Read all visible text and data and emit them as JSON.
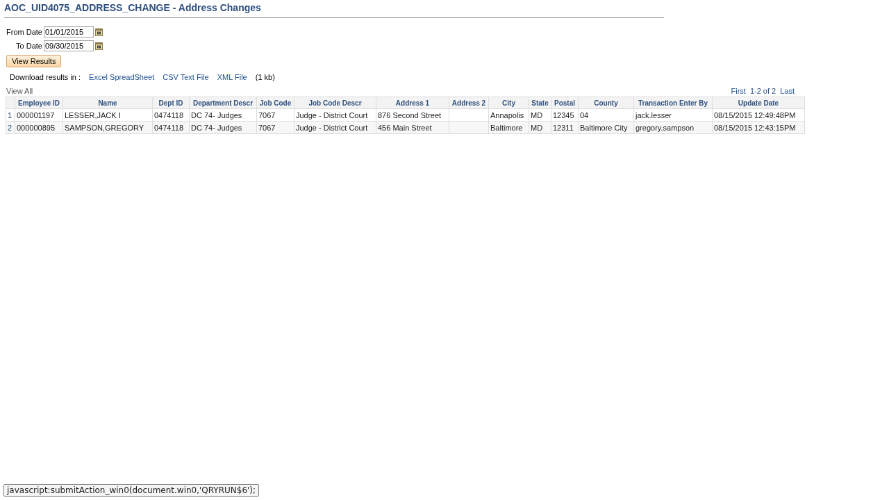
{
  "title": "AOC_UID4075_ADDRESS_CHANGE - Address Changes",
  "date_fields": [
    {
      "label": "From Date",
      "value": "01/01/2015"
    },
    {
      "label": "To Date",
      "value": "09/30/2015"
    }
  ],
  "view_button": "View Results",
  "download": {
    "label": "Download results in :",
    "links": [
      "Excel SpreadSheet",
      "CSV Text File",
      "XML File"
    ],
    "size": "(1 kb)"
  },
  "view_all": "View All",
  "pagination": {
    "first": "First",
    "range": "1-2 of 2",
    "last": "Last"
  },
  "table": {
    "columns": [
      "Employee ID",
      "Name",
      "Dept ID",
      "Department Descr",
      "Job Code",
      "Job Code Descr",
      "Address 1",
      "Address 2",
      "City",
      "State",
      "Postal",
      "County",
      "Transaction Enter By",
      "Update Date"
    ],
    "rows": [
      {
        "number": "1",
        "cells": [
          "000001197",
          "LESSER,JACK I",
          "0474118",
          "DC 74- Judges",
          "7067",
          "Judge - District Court",
          "876 Second Street",
          "",
          "Annapolis",
          "MD",
          "12345",
          "04",
          "jack.lesser",
          "08/15/2015 12:49:48PM"
        ]
      },
      {
        "number": "2",
        "cells": [
          "000000895",
          "SAMPSON,GREGORY",
          "0474118",
          "DC 74- Judges",
          "7067",
          "Judge - District Court",
          "456 Main Street",
          "",
          "Baltimore",
          "MD",
          "12311",
          "Baltimore City",
          "gregory.sampson",
          "08/15/2015 12:43:15PM"
        ]
      }
    ]
  },
  "status_bar": "javascript:submitAction_win0(document.win0,'QRYRUN$6');"
}
